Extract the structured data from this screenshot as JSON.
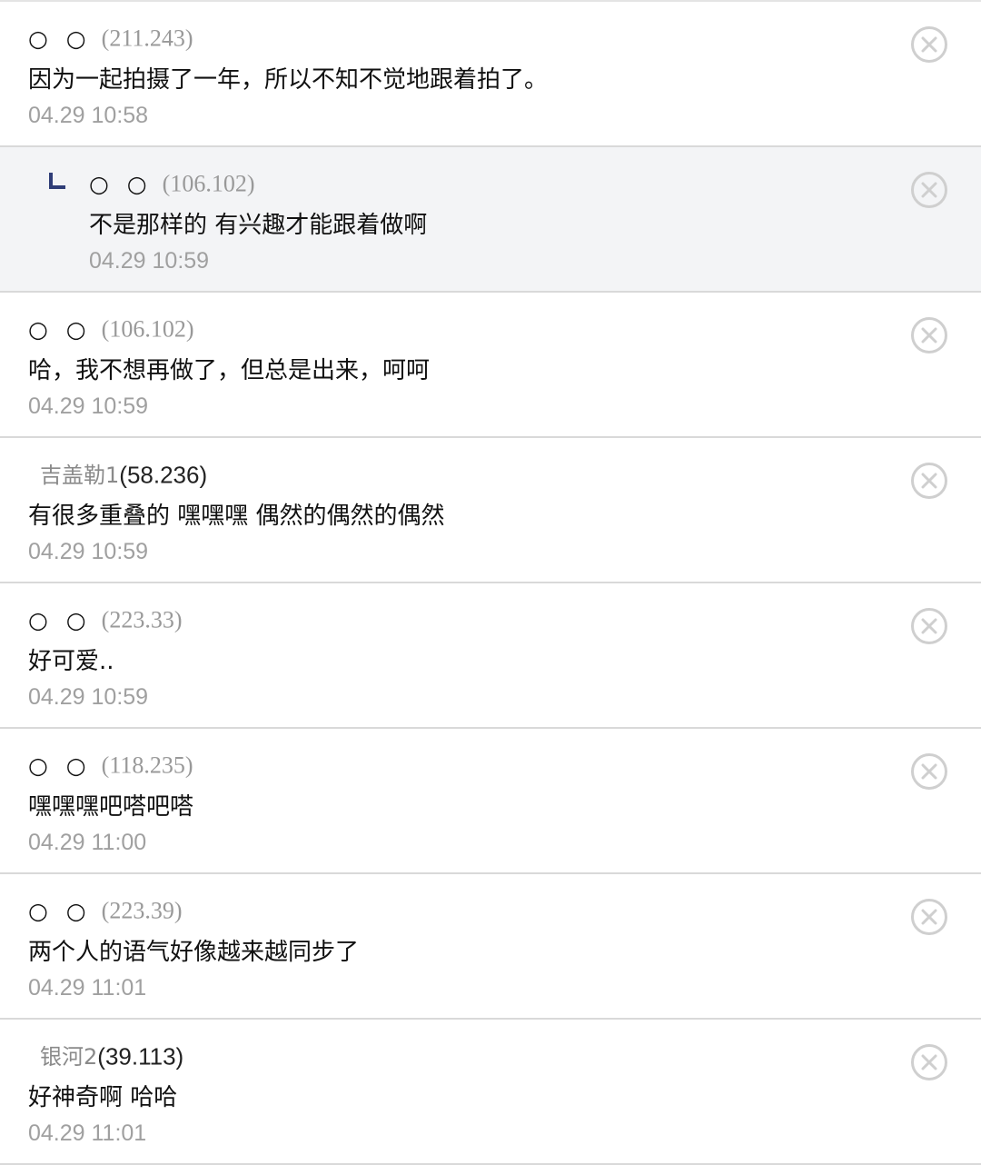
{
  "comments": [
    {
      "nick": "○ ○",
      "ip": "(211.243)",
      "text": "因为一起拍摄了一年，所以不知不觉地跟着拍了。",
      "time": "04.29 10:58"
    },
    {
      "nick": "○ ○",
      "ip": "(106.102)",
      "text": "不是那样的 有兴趣才能跟着做啊",
      "time": "04.29 10:59"
    },
    {
      "nick": "○ ○",
      "ip": "(106.102)",
      "text": "哈，我不想再做了，但总是出来，呵呵",
      "time": "04.29 10:59"
    },
    {
      "nick": "吉盖勒1",
      "ip": "(58.236)",
      "text": "有很多重叠的 嘿嘿嘿 偶然的偶然的偶然",
      "time": "04.29 10:59"
    },
    {
      "nick": "○ ○",
      "ip": "(223.33)",
      "text": "好可爱..",
      "time": "04.29 10:59"
    },
    {
      "nick": "○ ○",
      "ip": "(118.235)",
      "text": "嘿嘿嘿吧嗒吧嗒",
      "time": "04.29 11:00"
    },
    {
      "nick": "○ ○",
      "ip": "(223.39)",
      "text": "两个人的语气好像越来越同步了",
      "time": "04.29 11:01"
    },
    {
      "nick": "银河2",
      "ip": "(39.113)",
      "text": "好神奇啊 哈哈",
      "time": "04.29 11:01"
    }
  ],
  "icons": {
    "delete": "close-circle-icon",
    "reply": "reply-arrow-icon"
  },
  "colors": {
    "reply_background": "#f3f4f6",
    "reply_marker": "#2f3d77",
    "divider": "#d9d9d9",
    "timestamp": "#a0a0a0",
    "delete_icon": "#cfcfcf"
  }
}
